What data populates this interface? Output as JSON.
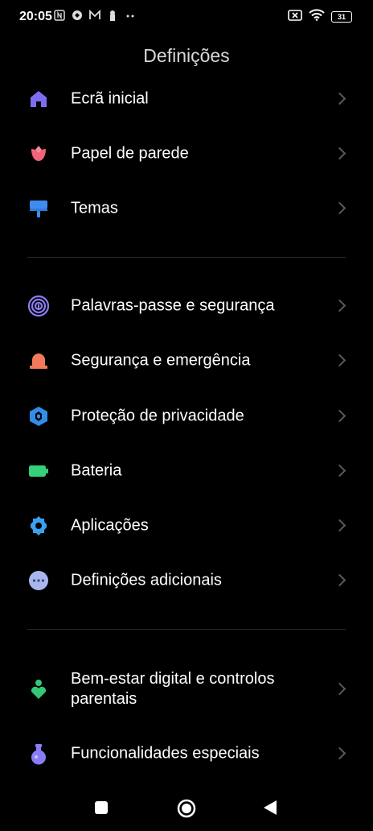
{
  "status": {
    "time": "20:05",
    "battery": "31"
  },
  "page": {
    "title": "Definições"
  },
  "items": [
    {
      "label": "Ecrã inicial",
      "icon": "home-icon",
      "color": "#7d6ef0"
    },
    {
      "label": "Papel de parede",
      "icon": "tulip-icon",
      "color": "#f0637a"
    },
    {
      "label": "Temas",
      "icon": "paint-roller-icon",
      "color": "#3d8df0"
    },
    {
      "label": "Palavras-passe e segurança",
      "icon": "fingerprint-icon",
      "color": "#8b7cf5"
    },
    {
      "label": "Segurança e emergência",
      "icon": "alarm-icon",
      "color": "#f27a5a"
    },
    {
      "label": "Proteção de privacidade",
      "icon": "privacy-cube-icon",
      "color": "#2f8ee8"
    },
    {
      "label": "Bateria",
      "icon": "battery-icon",
      "color": "#34d07a"
    },
    {
      "label": "Aplicações",
      "icon": "gear-icon",
      "color": "#3aa0f0"
    },
    {
      "label": "Definições adicionais",
      "icon": "more-dots-icon",
      "color": "#a9b6ee"
    },
    {
      "label": "Bem-estar digital e controlos parentais",
      "icon": "wellbeing-icon",
      "color": "#35c776"
    },
    {
      "label": "Funcionalidades especiais",
      "icon": "potion-icon",
      "color": "#8a7cf5"
    }
  ]
}
